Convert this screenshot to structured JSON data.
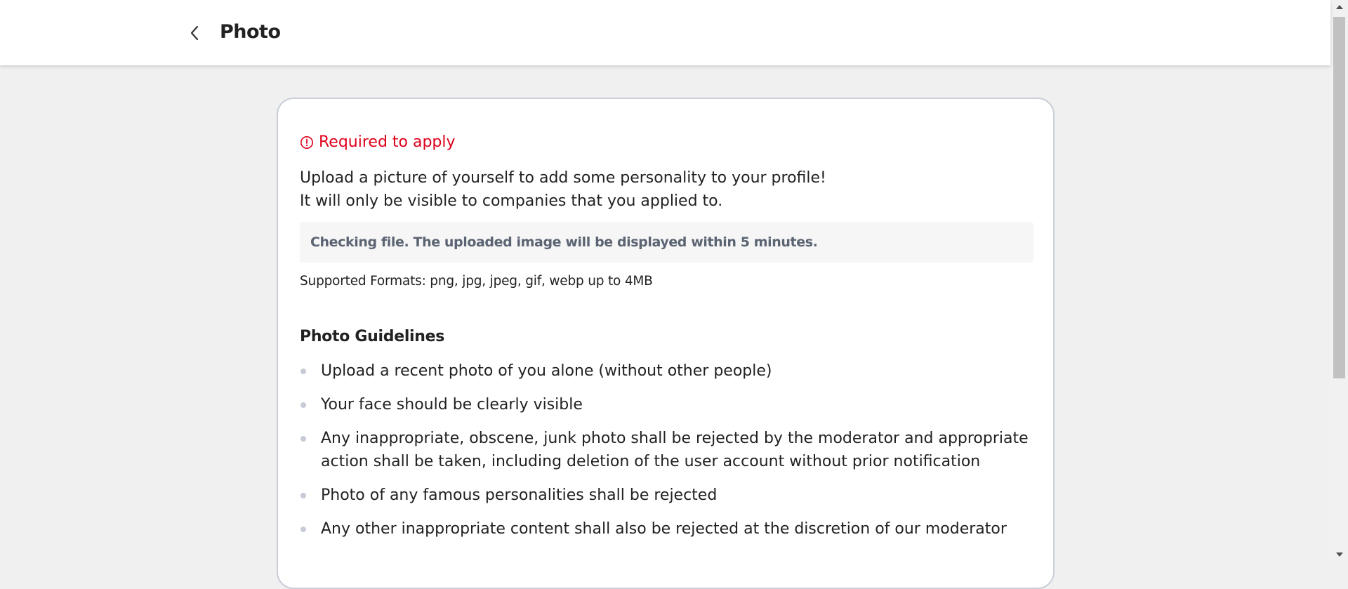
{
  "header": {
    "title": "Photo",
    "back_icon": "chevron-left-icon"
  },
  "card": {
    "required_icon": "alert-circle-icon",
    "required_text": "Required to apply",
    "description_line1": "Upload a picture of yourself to add some personality to your profile!",
    "description_line2": "It will only be visible to companies that you applied to.",
    "notice": "Checking file. The uploaded image will be displayed within 5 minutes.",
    "formats": "Supported Formats: png, jpg, jpeg, gif, webp up to 4MB",
    "guidelines_title": "Photo Guidelines",
    "guidelines": [
      "Upload a recent photo of you alone (without other people)",
      "Your face should be clearly visible",
      "Any inappropriate, obscene, junk photo shall be rejected by the moderator and appropriate action shall be taken, including deletion of the user account without prior notification",
      "Photo of any famous personalities shall be rejected",
      "Any other inappropriate content shall also be rejected at the discretion of our moderator"
    ]
  },
  "colors": {
    "required": "#e0001b",
    "notice_text": "#5b6472",
    "notice_bg": "#f6f6f6",
    "page_bg": "#f0f0f0",
    "card_border": "#c9ced8"
  }
}
